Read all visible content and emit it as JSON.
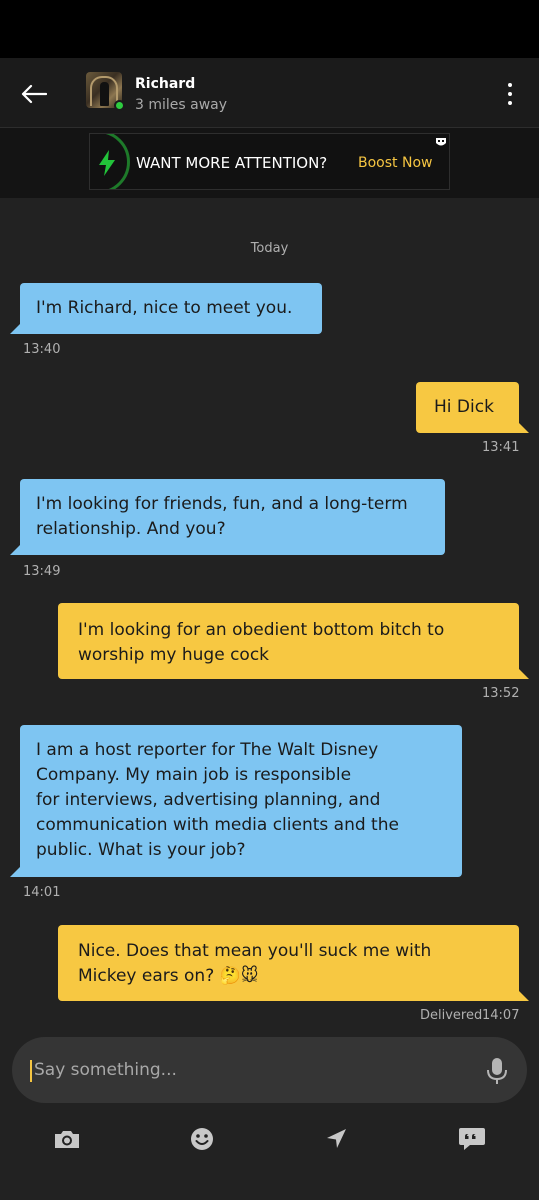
{
  "header": {
    "name": "Richard",
    "distance": "3 miles away",
    "online": true
  },
  "promo": {
    "text": "WANT MORE ATTENTION?",
    "cta": "Boost Now"
  },
  "chat": {
    "day_separator": "Today",
    "messages": [
      {
        "dir": "in",
        "text": "I'm Richard, nice to meet you.",
        "time": "13:40"
      },
      {
        "dir": "out",
        "text": "Hi Dick",
        "time": "13:41"
      },
      {
        "dir": "in",
        "line1": "I'm looking for friends, fun, and a long-term",
        "line2": "relationship. And you?",
        "time": "13:49"
      },
      {
        "dir": "out",
        "line1": "I'm looking for an obedient bottom bitch to",
        "line2": "worship my huge cock",
        "time": "13:52"
      },
      {
        "dir": "in",
        "line1": "I am a host reporter for The Walt Disney",
        "line2": "Company. My main job is responsible",
        "line3": "for interviews, advertising planning, and",
        "line4": "communication with media clients and the",
        "line5": "public. What is your job?",
        "time": "14:01"
      },
      {
        "dir": "out",
        "line1": "Nice. Does that mean you'll suck me with",
        "line2": "Mickey ears on? 🤔🐭",
        "time": "14:07",
        "status": "Delivered"
      }
    ]
  },
  "composer": {
    "placeholder": "Say something..."
  },
  "toolbar": {
    "icons": [
      "camera-icon",
      "smiley-icon",
      "location-arrow-icon",
      "saved-phrases-icon"
    ]
  },
  "colors": {
    "incoming_bubble": "#7ec5f2",
    "outgoing_bubble": "#f7c842",
    "accent": "#f5c542",
    "online": "#2ecc40"
  }
}
